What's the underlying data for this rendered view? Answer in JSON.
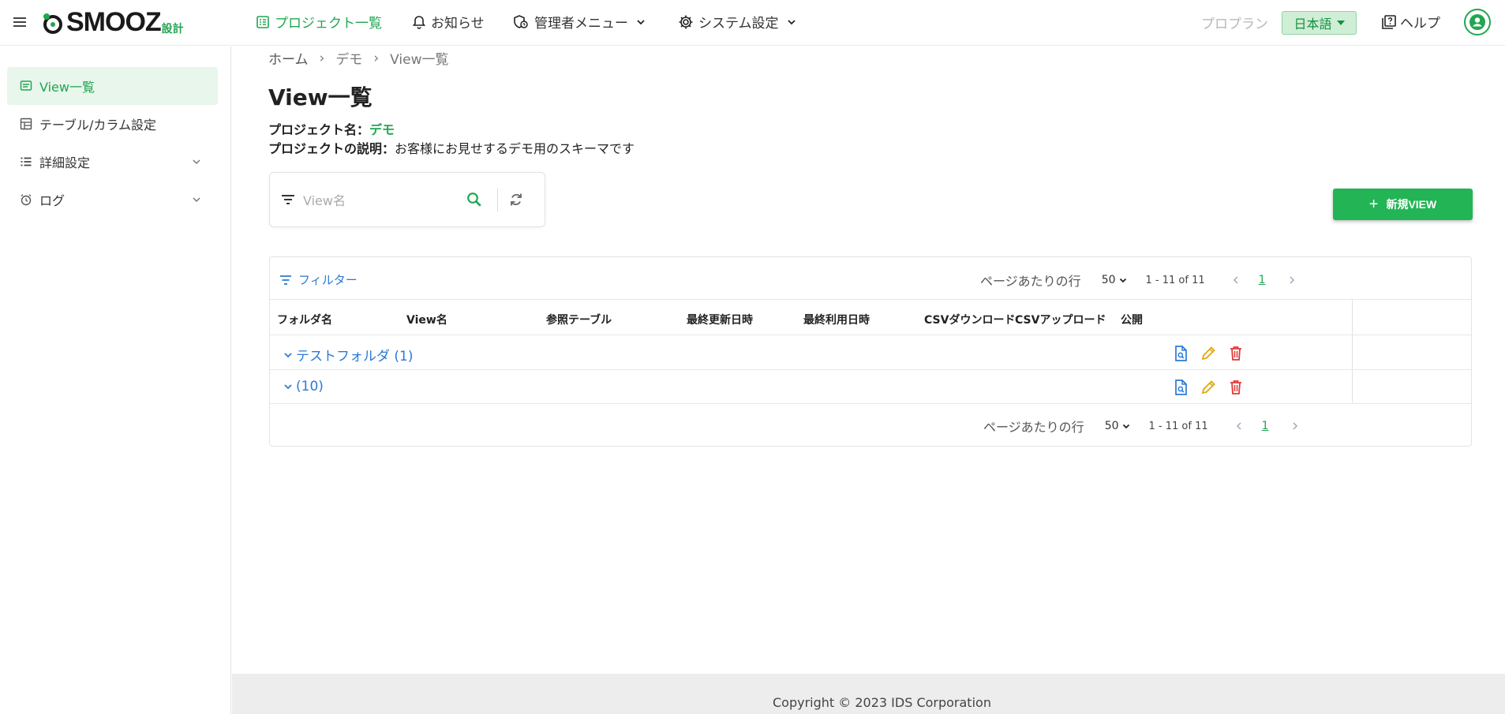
{
  "header": {
    "logo_text": "SMOOZ",
    "logo_sub": "設計",
    "nav": [
      {
        "label": "プロジェクト一覧",
        "icon": "project-list-icon"
      },
      {
        "label": "お知らせ",
        "icon": "bell-icon"
      },
      {
        "label": "管理者メニュー",
        "icon": "admin-shield-icon"
      },
      {
        "label": "システム設定",
        "icon": "gear-icon"
      }
    ],
    "plan_label": "プロプラン",
    "language": "日本語",
    "help_label": "ヘルプ"
  },
  "sidebar": {
    "items": [
      {
        "label": "View一覧",
        "icon": "view-list-icon",
        "active": true
      },
      {
        "label": "テーブル/カラム設定",
        "icon": "table-icon"
      },
      {
        "label": "詳細設定",
        "icon": "list-icon"
      },
      {
        "label": "ログ",
        "icon": "alarm-clock-icon"
      }
    ]
  },
  "breadcrumb": {
    "items": [
      "ホーム",
      "デモ",
      "View一覧"
    ]
  },
  "page": {
    "title": "View一覧",
    "project_name_label": "プロジェクト名：",
    "project_name": "デモ",
    "project_desc_label": "プロジェクトの説明：",
    "project_desc": "お客様にお見せするデモ用のスキーマです"
  },
  "search": {
    "placeholder": "View名"
  },
  "new_button": {
    "label": "新規VIEW"
  },
  "table": {
    "filter_label": "フィルター",
    "rows_per_page_label": "ページあたりの行",
    "rows_per_page": "50",
    "range_text": "1 - 11 of 11",
    "current_page": "1",
    "columns": [
      "フォルダ名",
      "View名",
      "参照テーブル",
      "最終更新日時",
      "最終利用日時",
      "CSVダウンロード",
      "CSVアップロード",
      "公開"
    ],
    "rows": [
      {
        "folder": "テストフォルダ (1)"
      },
      {
        "folder": "(10)"
      }
    ]
  },
  "footer": {
    "copyright": "Copyright © 2023 IDS Corporation"
  },
  "colors": {
    "accent": "#21a651",
    "link": "#2a7ad5",
    "edit": "#e2a60e",
    "delete": "#e53935"
  }
}
